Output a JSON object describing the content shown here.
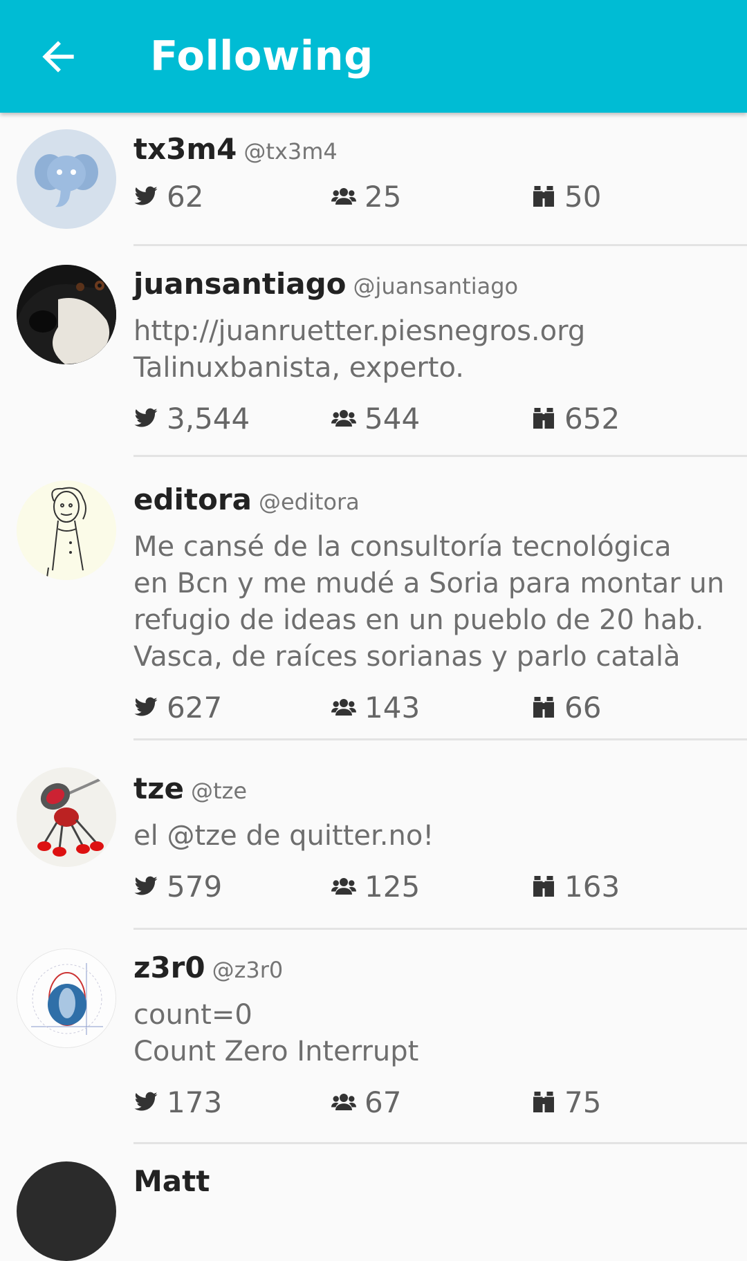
{
  "appbar": {
    "title": "Following",
    "back_icon": "arrow-left-icon",
    "color": "#00bcd4"
  },
  "users": [
    {
      "name": "tx3m4",
      "handle": "@tx3m4",
      "bio": "",
      "notices": "62",
      "followers": "25",
      "following": "50"
    },
    {
      "name": "juansantiago",
      "handle": "@juansantiago",
      "bio": "http://juanruetter.piesnegros.org\nTalinuxbanista, experto.",
      "notices": "3,544",
      "followers": "544",
      "following": "652"
    },
    {
      "name": "editora",
      "handle": "@editora",
      "bio": "Me cansé de la consultoría tecnológica\nen Bcn y me mudé a Soria para montar un\nrefugio de ideas en un pueblo de 20 hab.\nVasca, de raíces sorianas y parlo català",
      "notices": "627",
      "followers": "143",
      "following": "66"
    },
    {
      "name": "tze",
      "handle": "@tze",
      "bio": "el @tze de quitter.no!",
      "notices": "579",
      "followers": "125",
      "following": "163"
    },
    {
      "name": "z3r0",
      "handle": "@z3r0",
      "bio": "count=0\nCount Zero Interrupt",
      "notices": "173",
      "followers": "67",
      "following": "75"
    },
    {
      "name": "Matt",
      "handle": "",
      "bio": "",
      "notices": "",
      "followers": "",
      "following": ""
    }
  ]
}
